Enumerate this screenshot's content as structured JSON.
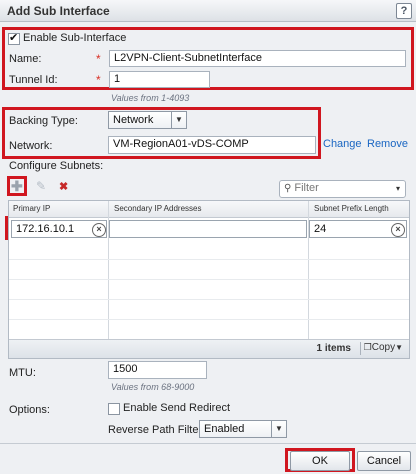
{
  "dialog": {
    "title": "Add Sub Interface",
    "help_icon": "?"
  },
  "enable_sub_interface": {
    "label": "Enable Sub-Interface",
    "checked": true
  },
  "name": {
    "label": "Name:",
    "value": "L2VPN-Client-SubnetInterface",
    "required_mark": "*"
  },
  "tunnel_id": {
    "label": "Tunnel Id:",
    "value": "1",
    "required_mark": "*",
    "hint": "Values from 1-4093"
  },
  "backing_type": {
    "label": "Backing Type:",
    "selected": "Network"
  },
  "network": {
    "label": "Network:",
    "value": "VM-RegionA01-vDS-COMP",
    "change_link": "Change",
    "remove_link": "Remove"
  },
  "subnets": {
    "section_label": "Configure Subnets:",
    "filter_placeholder": "Filter",
    "columns": [
      "Primary IP",
      "Secondary IP Addresses",
      "Subnet Prefix Length"
    ],
    "rows": [
      {
        "primary_ip": "172.16.10.1",
        "secondary_ips": "",
        "prefix_length": "24"
      }
    ],
    "footer_count": "1 items",
    "copy_label": "Copy"
  },
  "mtu": {
    "label": "MTU:",
    "value": "1500",
    "hint": "Values from 68-9000"
  },
  "options": {
    "label": "Options:",
    "send_redirect_label": "Enable Send Redirect",
    "send_redirect_checked": false,
    "reverse_path_label": "Reverse Path Filter:",
    "reverse_path_value": "Enabled"
  },
  "buttons": {
    "ok": "OK",
    "cancel": "Cancel"
  },
  "colors": {
    "highlight": "#d0161f",
    "link": "#1a66c2",
    "required": "#d93025"
  }
}
